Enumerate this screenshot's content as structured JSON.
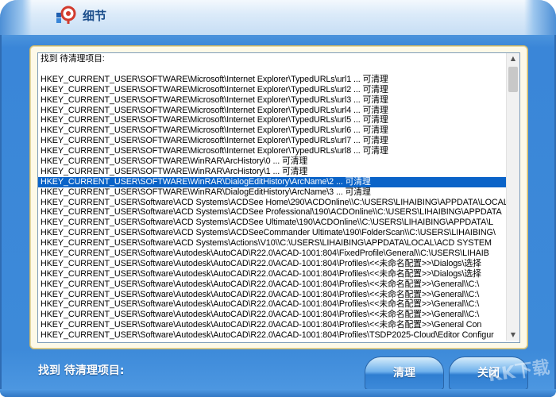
{
  "window": {
    "title": "细节"
  },
  "list": {
    "header": "找到 待清理项目:",
    "rows": [
      "HKEY_CURRENT_USER\\SOFTWARE\\Microsoft\\Internet Explorer\\TypedURLs\\url1 ... 可清理",
      "HKEY_CURRENT_USER\\SOFTWARE\\Microsoft\\Internet Explorer\\TypedURLs\\url2 ... 可清理",
      "HKEY_CURRENT_USER\\SOFTWARE\\Microsoft\\Internet Explorer\\TypedURLs\\url3 ... 可清理",
      "HKEY_CURRENT_USER\\SOFTWARE\\Microsoft\\Internet Explorer\\TypedURLs\\url4 ... 可清理",
      "HKEY_CURRENT_USER\\SOFTWARE\\Microsoft\\Internet Explorer\\TypedURLs\\url5 ... 可清理",
      "HKEY_CURRENT_USER\\SOFTWARE\\Microsoft\\Internet Explorer\\TypedURLs\\url6 ... 可清理",
      "HKEY_CURRENT_USER\\SOFTWARE\\Microsoft\\Internet Explorer\\TypedURLs\\url7 ... 可清理",
      "HKEY_CURRENT_USER\\SOFTWARE\\Microsoft\\Internet Explorer\\TypedURLs\\url8 ... 可清理",
      "HKEY_CURRENT_USER\\SOFTWARE\\WinRAR\\ArcHistory\\0 ... 可清理",
      "HKEY_CURRENT_USER\\SOFTWARE\\WinRAR\\ArcHistory\\1 ... 可清理",
      "HKEY_CURRENT_USER\\SOFTWARE\\WinRAR\\DialogEditHistory\\ArcName\\2 ... 可清理",
      "HKEY_CURRENT_USER\\SOFTWARE\\WinRAR\\DialogEditHistory\\ArcName\\3 ... 可清理",
      "HKEY_CURRENT_USER\\Software\\ACD Systems\\ACDSee Home\\290\\ACDOnline\\\\C:\\USERS\\LIHAIBING\\APPDATA\\LOCAL",
      "HKEY_CURRENT_USER\\Software\\ACD Systems\\ACDSee Professional\\190\\ACDOnline\\\\C:\\USERS\\LIHAIBING\\APPDATA",
      "HKEY_CURRENT_USER\\Software\\ACD Systems\\ACDSee Ultimate\\190\\ACDOnline\\\\C:\\USERS\\LIHAIBING\\APPDATA\\L",
      "HKEY_CURRENT_USER\\Software\\ACD Systems\\ACDSeeCommander Ultimate\\190\\FolderScan\\\\C:\\USERS\\LIHAIBING\\",
      "HKEY_CURRENT_USER\\Software\\ACD Systems\\Actions\\V10\\\\C:\\USERS\\LIHAIBING\\APPDATA\\LOCAL\\ACD SYSTEM",
      "HKEY_CURRENT_USER\\Software\\Autodesk\\AutoCAD\\R22.0\\ACAD-1001:804\\FixedProfile\\General\\\\C:\\USERS\\LIHAIB",
      "HKEY_CURRENT_USER\\Software\\Autodesk\\AutoCAD\\R22.0\\ACAD-1001:804\\Profiles\\<<未命名配置>>\\Dialogs\\选择",
      "HKEY_CURRENT_USER\\Software\\Autodesk\\AutoCAD\\R22.0\\ACAD-1001:804\\Profiles\\<<未命名配置>>\\Dialogs\\选择",
      "HKEY_CURRENT_USER\\Software\\Autodesk\\AutoCAD\\R22.0\\ACAD-1001:804\\Profiles\\<<未命名配置>>\\General\\\\C:\\",
      "HKEY_CURRENT_USER\\Software\\Autodesk\\AutoCAD\\R22.0\\ACAD-1001:804\\Profiles\\<<未命名配置>>\\General\\\\C:\\",
      "HKEY_CURRENT_USER\\Software\\Autodesk\\AutoCAD\\R22.0\\ACAD-1001:804\\Profiles\\<<未命名配置>>\\General\\\\C:\\",
      "HKEY_CURRENT_USER\\Software\\Autodesk\\AutoCAD\\R22.0\\ACAD-1001:804\\Profiles\\<<未命名配置>>\\General\\\\C:\\",
      "HKEY_CURRENT_USER\\Software\\Autodesk\\AutoCAD\\R22.0\\ACAD-1001:804\\Profiles\\<<未命名配置>>\\General Con",
      "HKEY_CURRENT_USER\\Software\\Autodesk\\AutoCAD\\R22.0\\ACAD-1001:804\\Profiles\\TSDP2025-Cloud\\Editor Configur"
    ],
    "selected_index": 10
  },
  "status": {
    "text": "找到 待清理项目:"
  },
  "buttons": {
    "clean_label": "清理",
    "close_label": "关闭"
  },
  "watermark": "KK下载",
  "colors": {
    "selection": "#0a63c8",
    "frame": "#3a86d8"
  }
}
